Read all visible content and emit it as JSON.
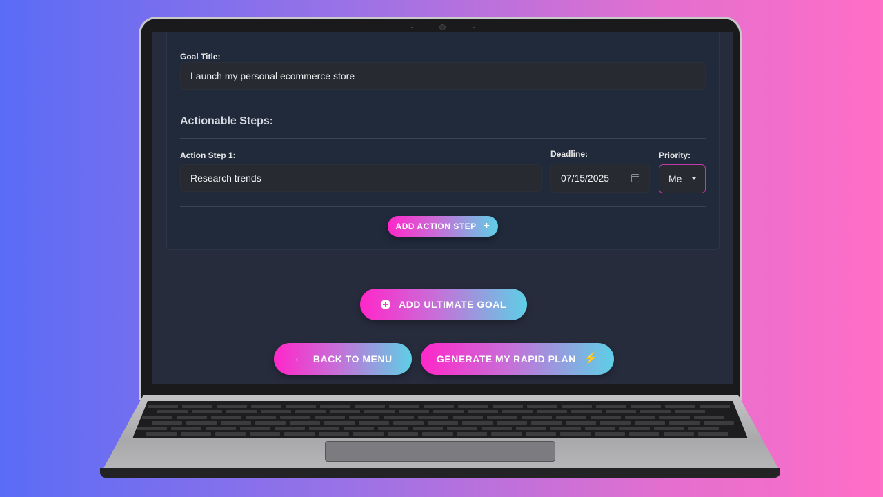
{
  "form": {
    "goal_title_label": "Goal Title:",
    "goal_title_value": "Launch my personal ecommerce store",
    "section_title": "Actionable Steps:",
    "step_label": "Action Step 1:",
    "step_value": "Research trends",
    "deadline_label": "Deadline:",
    "deadline_value": "07/15/2025",
    "priority_label": "Priority:",
    "priority_value": "Me"
  },
  "buttons": {
    "add_action_step": "ADD ACTION STEP",
    "add_action_step_icon": "+",
    "add_ultimate_goal": "ADD ULTIMATE GOAL",
    "back_to_menu": "BACK TO MENU",
    "back_icon": "←",
    "generate_plan": "GENERATE MY RAPID PLAN",
    "generate_icon": "⚡"
  },
  "colors": {
    "accent_pink": "#ff27c9",
    "accent_cyan": "#5ecfe6",
    "card_bg": "#202a3b",
    "screen_bg": "#272c3d"
  }
}
